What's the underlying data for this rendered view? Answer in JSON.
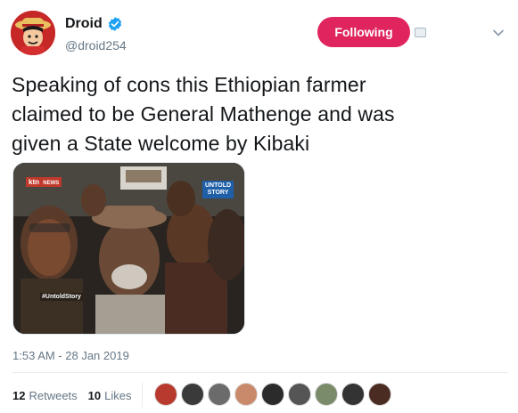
{
  "tweet": {
    "display_name": "Droid",
    "handle": "@droid254",
    "follow_label": "Following",
    "text_lines": [
      "Speaking of cons this Ethiopian farmer",
      "claimed to be General Mathenge and was",
      "given a State welcome by Kibaki"
    ],
    "media_overlay": {
      "channel": "ktn",
      "channel_sub": "NEWS",
      "badge_line1": "UNTOLD",
      "badge_line2": "STORY",
      "caption_tag": "#UntoldStory"
    },
    "timestamp": "1:53 AM - 28 Jan 2019",
    "retweets_count": "12",
    "retweets_label": "Retweets",
    "likes_count": "10",
    "likes_label": "Likes"
  },
  "colors": {
    "follow_button": "#e0245e",
    "verified_badge": "#1da1f2",
    "muted_text": "#657786",
    "divider": "#e6ecf0"
  },
  "icons": [
    "verified-icon",
    "caret-down-icon",
    "translate-icon"
  ],
  "liker_colors": [
    "#b83a2e",
    "#3a3a3a",
    "#6b6b6b",
    "#c98a6b",
    "#2b2b2b",
    "#555555",
    "#7a8b6a",
    "#333333",
    "#4a2c22"
  ]
}
